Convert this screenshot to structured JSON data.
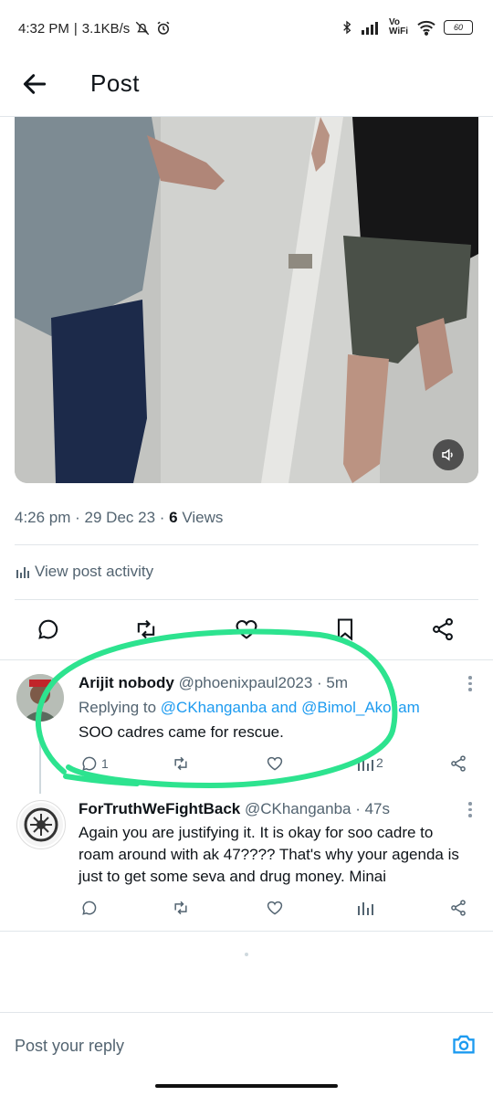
{
  "status": {
    "time": "4:32 PM",
    "network_speed": "3.1KB/s",
    "vowifi": "Vo WiFi",
    "battery": "60"
  },
  "header": {
    "title": "Post"
  },
  "post": {
    "meta_time": "4:26 pm · 29 Dec 23 · ",
    "views_count": "6",
    "views_label": " Views",
    "activity_label": "View post activity"
  },
  "replies": [
    {
      "name": "Arijit nobody",
      "handle": "@phoenixpaul2023 · 5m",
      "replying_prefix": "Replying to ",
      "replying_user1": "@CKhanganba",
      "replying_and": " and ",
      "replying_user2": "@Bimol_Akoijam",
      "text": "SOO cadres came for rescue.",
      "reply_count": "1",
      "views_count": "2"
    },
    {
      "name": "ForTruthWeFightBack",
      "handle": "@CKhanganba · 47s",
      "text": "Again you are justifying it. It is okay for soo cadre to roam around with ak 47???? That's why your agenda is just to get some seva and drug money. Minai"
    }
  ],
  "composer": {
    "placeholder": "Post your reply"
  },
  "colors": {
    "accent": "#1d9bf0",
    "annotation": "#2de38f",
    "muted": "#536471"
  }
}
